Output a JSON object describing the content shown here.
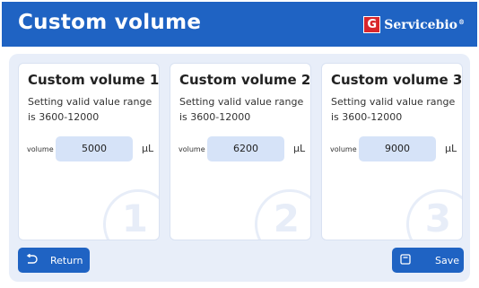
{
  "header": {
    "title": "Custom volume",
    "brand_logo_letter": "G",
    "brand_name": "Servicebio",
    "brand_reg": "®"
  },
  "cards": [
    {
      "title": "Custom volume 1",
      "description": "Setting valid value range is 3600-12000",
      "volume_label": "volume",
      "volume_value": "5000",
      "unit": "μL",
      "watermark": "1"
    },
    {
      "title": "Custom volume 2",
      "description": "Setting valid value range is 3600-12000",
      "volume_label": "volume",
      "volume_value": "6200",
      "unit": "μL",
      "watermark": "2"
    },
    {
      "title": "Custom volume 3",
      "description": "Setting valid value range is 3600-12000",
      "volume_label": "volume",
      "volume_value": "9000",
      "unit": "μL",
      "watermark": "3"
    }
  ],
  "buttons": {
    "return_label": "Return",
    "save_label": "Save"
  },
  "colors": {
    "primary": "#1f63c3",
    "panel_bg": "#e8eef9",
    "input_bg": "#d6e3f8",
    "brand_red": "#d9262b"
  },
  "icons": {
    "return": "return-arrow-icon",
    "save": "save-icon"
  }
}
